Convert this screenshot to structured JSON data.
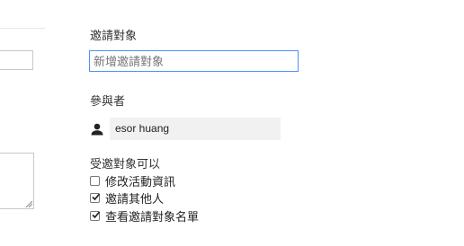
{
  "guests": {
    "heading": "邀請對象",
    "input_placeholder": "新增邀請對象",
    "input_value": ""
  },
  "participants": {
    "heading": "參與者",
    "list": [
      {
        "name": "esor huang",
        "icon": "person-icon"
      }
    ]
  },
  "permissions": {
    "heading": "受邀對象可以",
    "options": [
      {
        "label": "修改活動資訊",
        "checked": false
      },
      {
        "label": "邀請其他人",
        "checked": true
      },
      {
        "label": "查看邀請對象名單",
        "checked": true
      }
    ]
  }
}
